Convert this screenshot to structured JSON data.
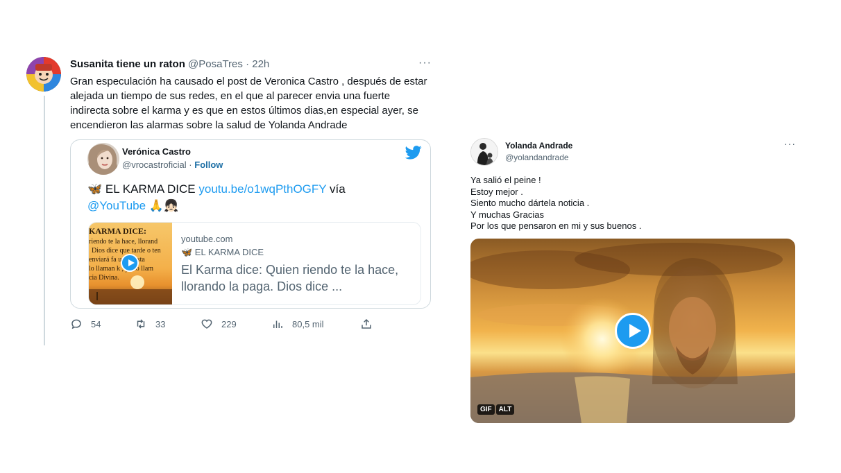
{
  "left_tweet": {
    "author_name": "Susanita tiene un raton",
    "author_handle": "@PosaTres",
    "separator": "·",
    "time": "22h",
    "more": "···",
    "text": "Gran especulación ha causado el post de Veronica Castro , después de estar alejada un tiempo de sus redes, en el que al parecer envia una fuerte indirecta sobre el karma y es que en estos últimos dias,en especial ayer, se encendieron las alarmas sobre la salud de Yolanda Andrade",
    "quote": {
      "name": "Verónica Castro",
      "handle": "@vrocastroficial",
      "separator": "·",
      "follow": "Follow",
      "text_prefix": "🦋 EL KARMA DICE ",
      "link": "youtu.be/o1wqPthOGFY",
      "text_via": " vía",
      "mention": "@YouTube",
      "emojis": " 🙏👧🏻",
      "card": {
        "domain": "youtube.com",
        "subtitle": "🦋 EL KARMA DICE",
        "title": "El Karma dice: Quien riendo te la hace, llorando la paga. Dios dice ...",
        "image_lines": [
          "KARMA DICE:",
          "riendo te la hace, llorand",
          "Dios dice que tarde o ten",
          "enviará fa      ura ajusta",
          "lo llaman k   , yo lo llam",
          "cia Divina."
        ]
      }
    },
    "actions": {
      "replies": "54",
      "retweets": "33",
      "likes": "229",
      "views": "80,5 mil"
    }
  },
  "right_tweet": {
    "author_name": "Yolanda Andrade",
    "author_handle": "@yolandandrade",
    "more": "···",
    "lines": [
      "Ya salió el peine !",
      "Estoy mejor .",
      "Siento mucho dártela noticia .",
      "Y muchas Gracias",
      "Por los que pensaron en mi y sus buenos ."
    ],
    "badges": [
      "GIF",
      "ALT"
    ]
  },
  "colors": {
    "accent": "#1d9bf0",
    "text": "#0f1419",
    "muted": "#536471",
    "border": "#cfd9de"
  }
}
